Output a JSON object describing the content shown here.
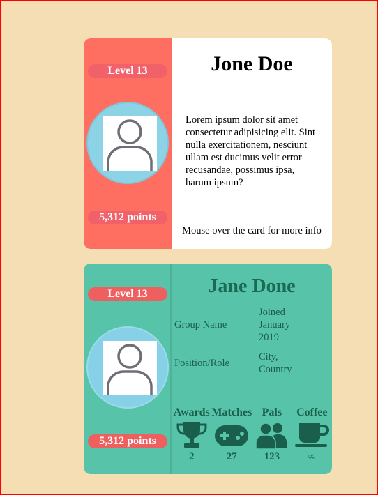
{
  "card1": {
    "level": "Level 13",
    "points": "5,312 points",
    "name": "Jone Doe",
    "description": "Lorem ipsum dolor sit amet consectetur adipisicing elit. Sint nulla exercitationem, nesciunt ullam est ducimus velit error recusandae, possimus ipsa, harum ipsum?",
    "hint": "Mouse over the card for more info"
  },
  "card2": {
    "level": "Level 13",
    "points": "5,312 points",
    "name": "Jane Done",
    "group": "Group Name",
    "joined": "Joined January 2019",
    "position": "Position/Role",
    "location": "City, Country",
    "stats": [
      {
        "label": "Awards",
        "value": "2",
        "icon": "trophy-icon"
      },
      {
        "label": "Matches",
        "value": "27",
        "icon": "gamepad-icon"
      },
      {
        "label": "Pals",
        "value": "123",
        "icon": "users-icon"
      },
      {
        "label": "Coffee",
        "value": "∞",
        "icon": "coffee-icon"
      }
    ]
  },
  "colors": {
    "background": "#f5deb3",
    "card1_side": "#ff6f61",
    "card2_bg": "#57c4a9",
    "pill": "#ee5f5f",
    "avatar": "#8cd3e6",
    "dark_green": "#1a6a54"
  }
}
